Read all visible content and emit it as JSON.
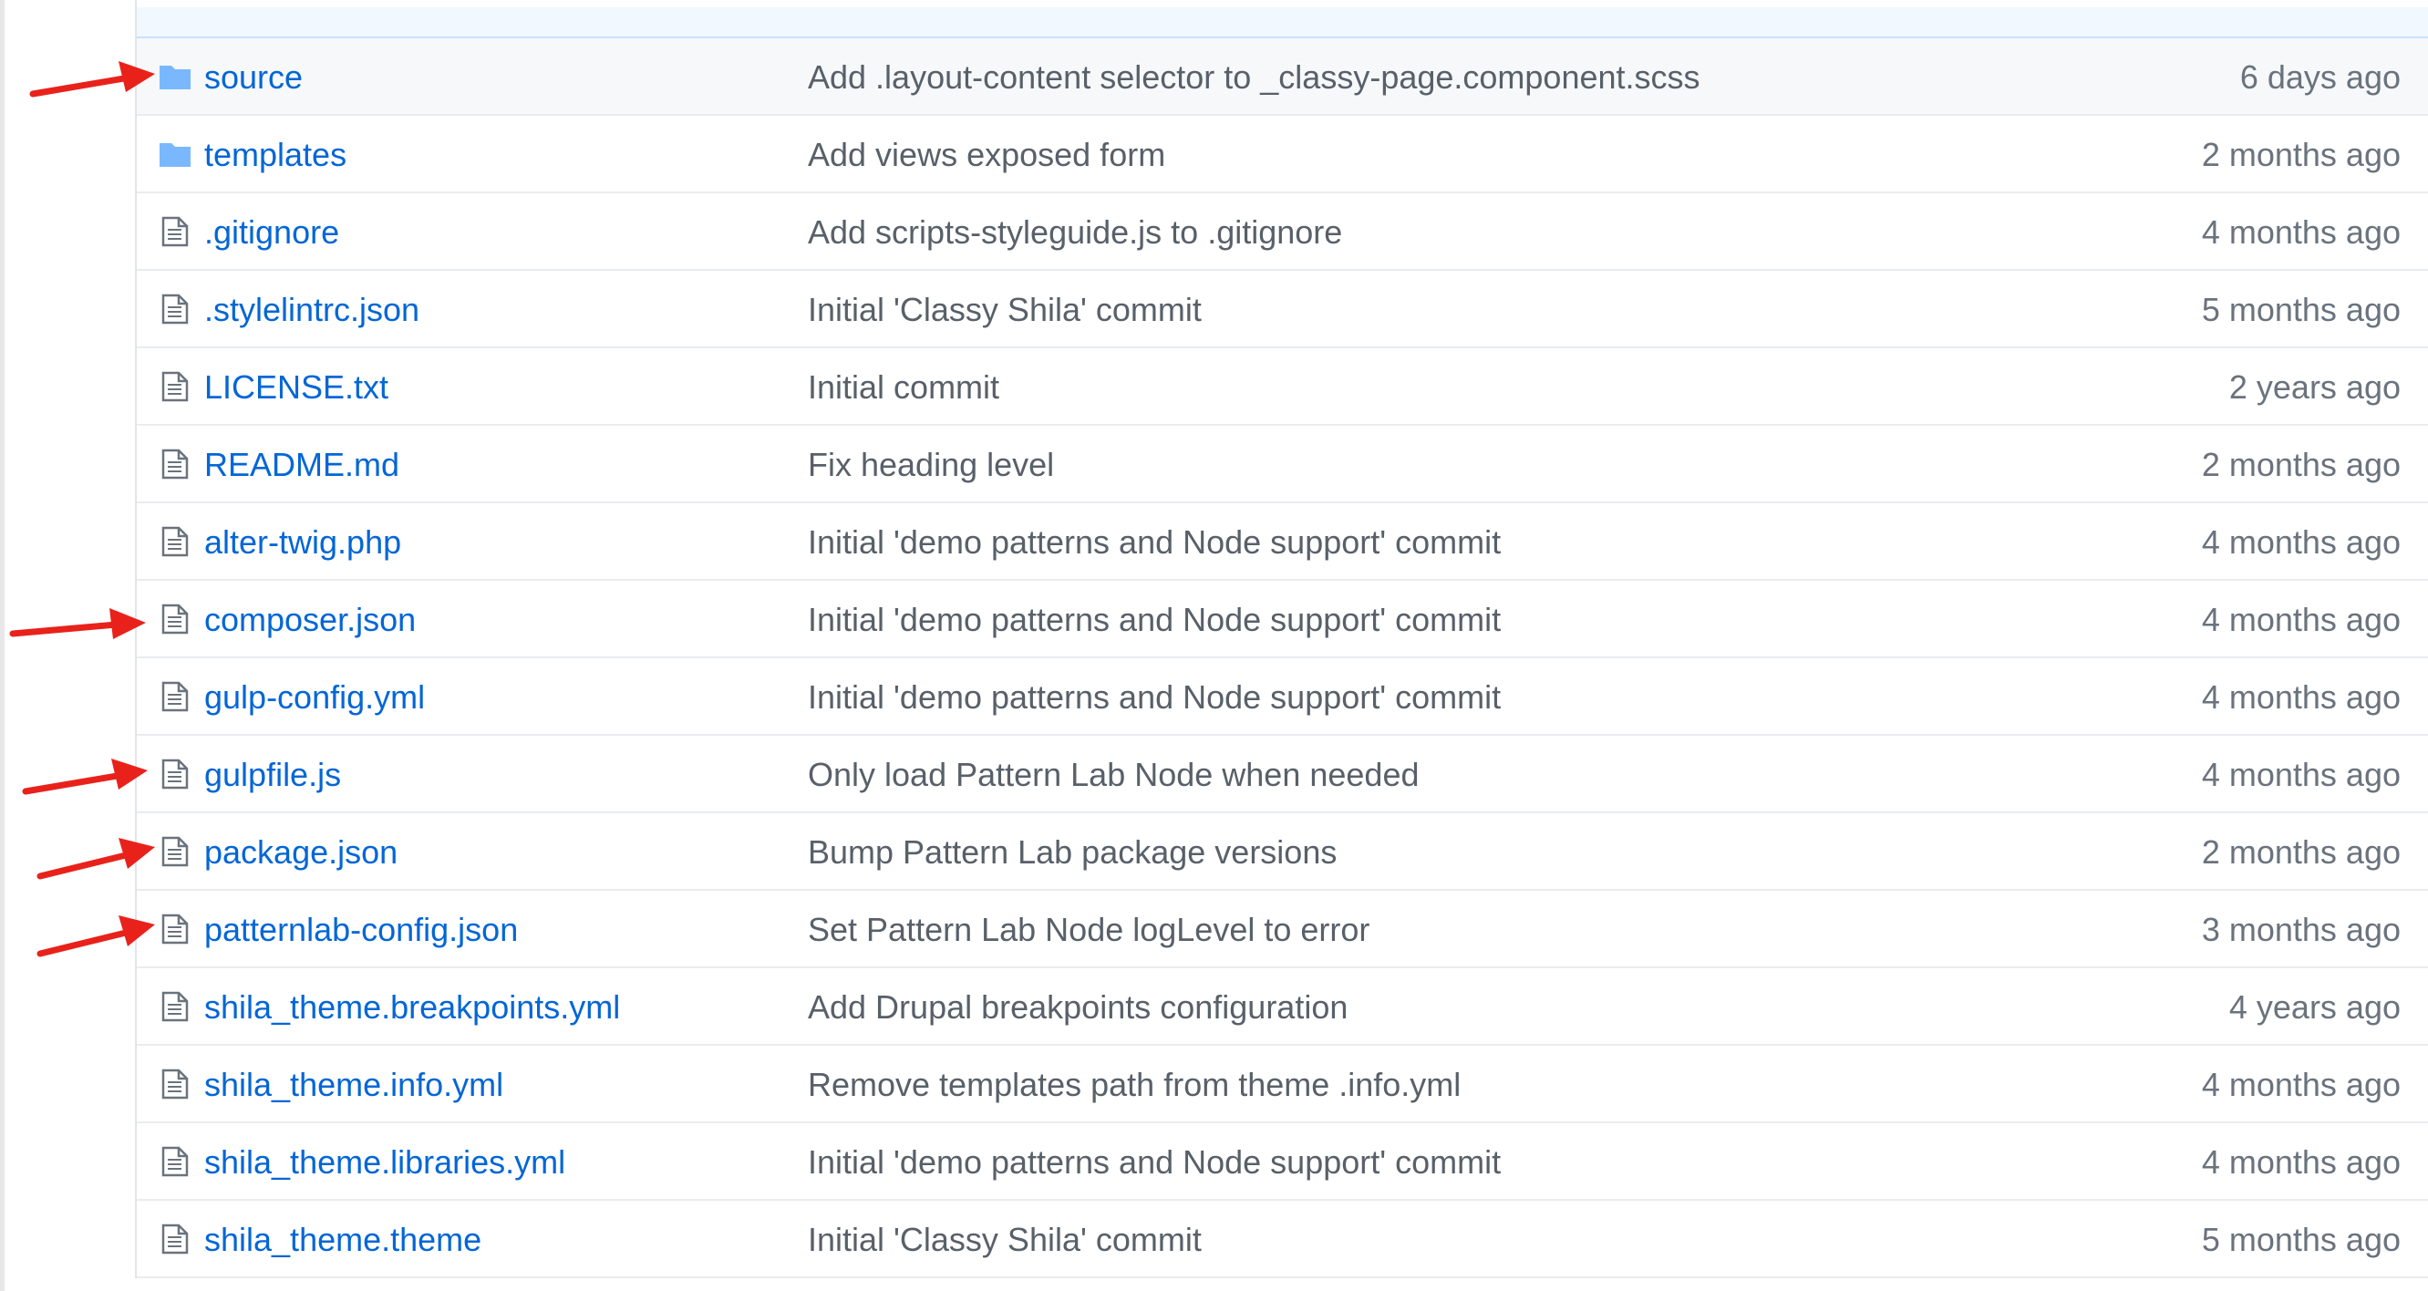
{
  "files": [
    {
      "type": "folder",
      "name": "source",
      "message": "Add .layout-content selector to _classy-page.component.scss",
      "age": "6 days ago"
    },
    {
      "type": "folder",
      "name": "templates",
      "message": "Add views exposed form",
      "age": "2 months ago"
    },
    {
      "type": "file",
      "name": ".gitignore",
      "message": "Add scripts-styleguide.js to .gitignore",
      "age": "4 months ago"
    },
    {
      "type": "file",
      "name": ".stylelintrc.json",
      "message": "Initial 'Classy Shila' commit",
      "age": "5 months ago"
    },
    {
      "type": "file",
      "name": "LICENSE.txt",
      "message": "Initial commit",
      "age": "2 years ago"
    },
    {
      "type": "file",
      "name": "README.md",
      "message": "Fix heading level",
      "age": "2 months ago"
    },
    {
      "type": "file",
      "name": "alter-twig.php",
      "message": "Initial 'demo patterns and Node support' commit",
      "age": "4 months ago"
    },
    {
      "type": "file",
      "name": "composer.json",
      "message": "Initial 'demo patterns and Node support' commit",
      "age": "4 months ago"
    },
    {
      "type": "file",
      "name": "gulp-config.yml",
      "message": "Initial 'demo patterns and Node support' commit",
      "age": "4 months ago"
    },
    {
      "type": "file",
      "name": "gulpfile.js",
      "message": "Only load Pattern Lab Node when needed",
      "age": "4 months ago"
    },
    {
      "type": "file",
      "name": "package.json",
      "message": "Bump Pattern Lab package versions",
      "age": "2 months ago"
    },
    {
      "type": "file",
      "name": "patternlab-config.json",
      "message": "Set Pattern Lab Node logLevel to error",
      "age": "3 months ago"
    },
    {
      "type": "file",
      "name": "shila_theme.breakpoints.yml",
      "message": "Add Drupal breakpoints configuration",
      "age": "4 years ago"
    },
    {
      "type": "file",
      "name": "shila_theme.info.yml",
      "message": "Remove templates path from theme .info.yml",
      "age": "4 months ago"
    },
    {
      "type": "file",
      "name": "shila_theme.libraries.yml",
      "message": "Initial 'demo patterns and Node support' commit",
      "age": "4 months ago"
    },
    {
      "type": "file",
      "name": "shila_theme.theme",
      "message": "Initial 'Classy Shila' commit",
      "age": "5 months ago"
    }
  ],
  "colors": {
    "link": "#0366d6",
    "message": "#586069",
    "age": "#6a737d",
    "folder_icon": "#79b8ff",
    "file_icon": "#6a737d",
    "annotation_arrow": "#e8221b"
  },
  "icons": {
    "folder": "folder-icon",
    "file": "file-icon",
    "annotation": "red-arrow-annotation"
  },
  "annotations": {
    "arrow_rows": [
      "source",
      "composer.json",
      "gulpfile.js",
      "package.json",
      "patternlab-config.json"
    ]
  }
}
